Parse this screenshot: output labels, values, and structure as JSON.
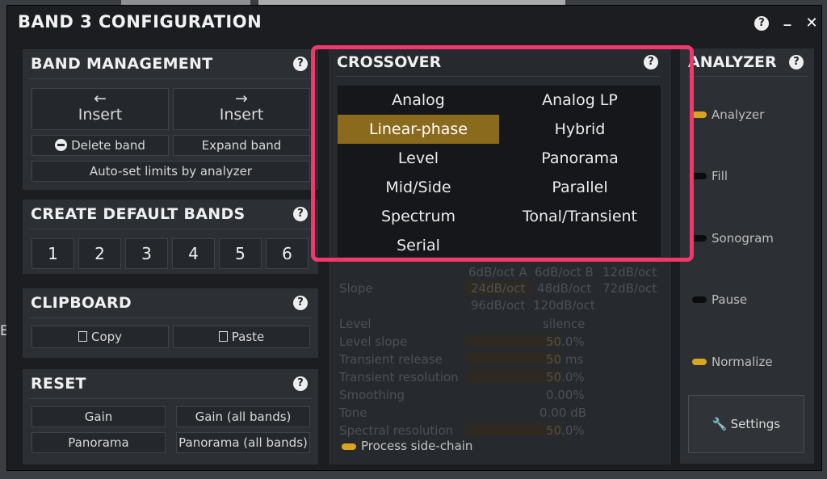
{
  "window": {
    "title": "BAND 3 CONFIGURATION",
    "help_glyph": "?",
    "minimize_glyph": "_",
    "close_glyph": "✕"
  },
  "band_management": {
    "title": "BAND MANAGEMENT",
    "insert_left_arrow": "←",
    "insert_left": "Insert",
    "insert_right_arrow": "→",
    "insert_right": "Insert",
    "delete_band": "Delete band",
    "expand_band": "Expand band",
    "auto_set": "Auto-set limits by analyzer"
  },
  "create_default_bands": {
    "title": "CREATE DEFAULT BANDS",
    "numbers": [
      "1",
      "2",
      "3",
      "4",
      "5",
      "6"
    ]
  },
  "clipboard": {
    "title": "CLIPBOARD",
    "copy": "Copy",
    "paste": "Paste"
  },
  "reset": {
    "title": "RESET",
    "gain": "Gain",
    "gain_all": "Gain (all bands)",
    "panorama": "Panorama",
    "panorama_all": "Panorama (all bands)"
  },
  "crossover": {
    "title": "CROSSOVER",
    "selected": "Linear-phase",
    "options": [
      "Analog",
      "Analog LP",
      "Linear-phase",
      "Hybrid",
      "Level",
      "Panorama",
      "Mid/Side",
      "Parallel",
      "Spectrum",
      "Tonal/Transient",
      "Serial"
    ]
  },
  "dim_params": {
    "slope_label": "Slope",
    "slopes": [
      "6dB/oct A",
      "6dB/oct B",
      "12dB/oct",
      "24dB/oct",
      "48dB/oct",
      "72dB/oct",
      "96dB/oct",
      "120dB/oct"
    ],
    "level": "Level",
    "level_value": "silence",
    "level_slope": "Level slope",
    "level_slope_value": "50.0%",
    "transient_release": "Transient release",
    "transient_release_value": "50 ms",
    "transient_resolution": "Transient resolution",
    "transient_resolution_value": "50.0%",
    "smoothing": "Smoothing",
    "smoothing_value": "0.00%",
    "tone": "Tone",
    "tone_value": "0.00 dB",
    "spectral_resolution": "Spectral resolution",
    "spectral_resolution_value": "50.0%",
    "process_side_chain": "Process side-chain"
  },
  "analyzer": {
    "title": "ANALYZER",
    "toggles": [
      {
        "label": "Analyzer",
        "on": true
      },
      {
        "label": "Fill",
        "on": false
      },
      {
        "label": "Sonogram",
        "on": false
      },
      {
        "label": "Pause",
        "on": false
      },
      {
        "label": "Normalize",
        "on": true
      }
    ],
    "settings": "Settings"
  },
  "colors": {
    "accent": "#d9a521",
    "selected_bg": "#8a6b1e",
    "highlight": "#f0386b"
  },
  "background_fragments": [
    "E"
  ]
}
